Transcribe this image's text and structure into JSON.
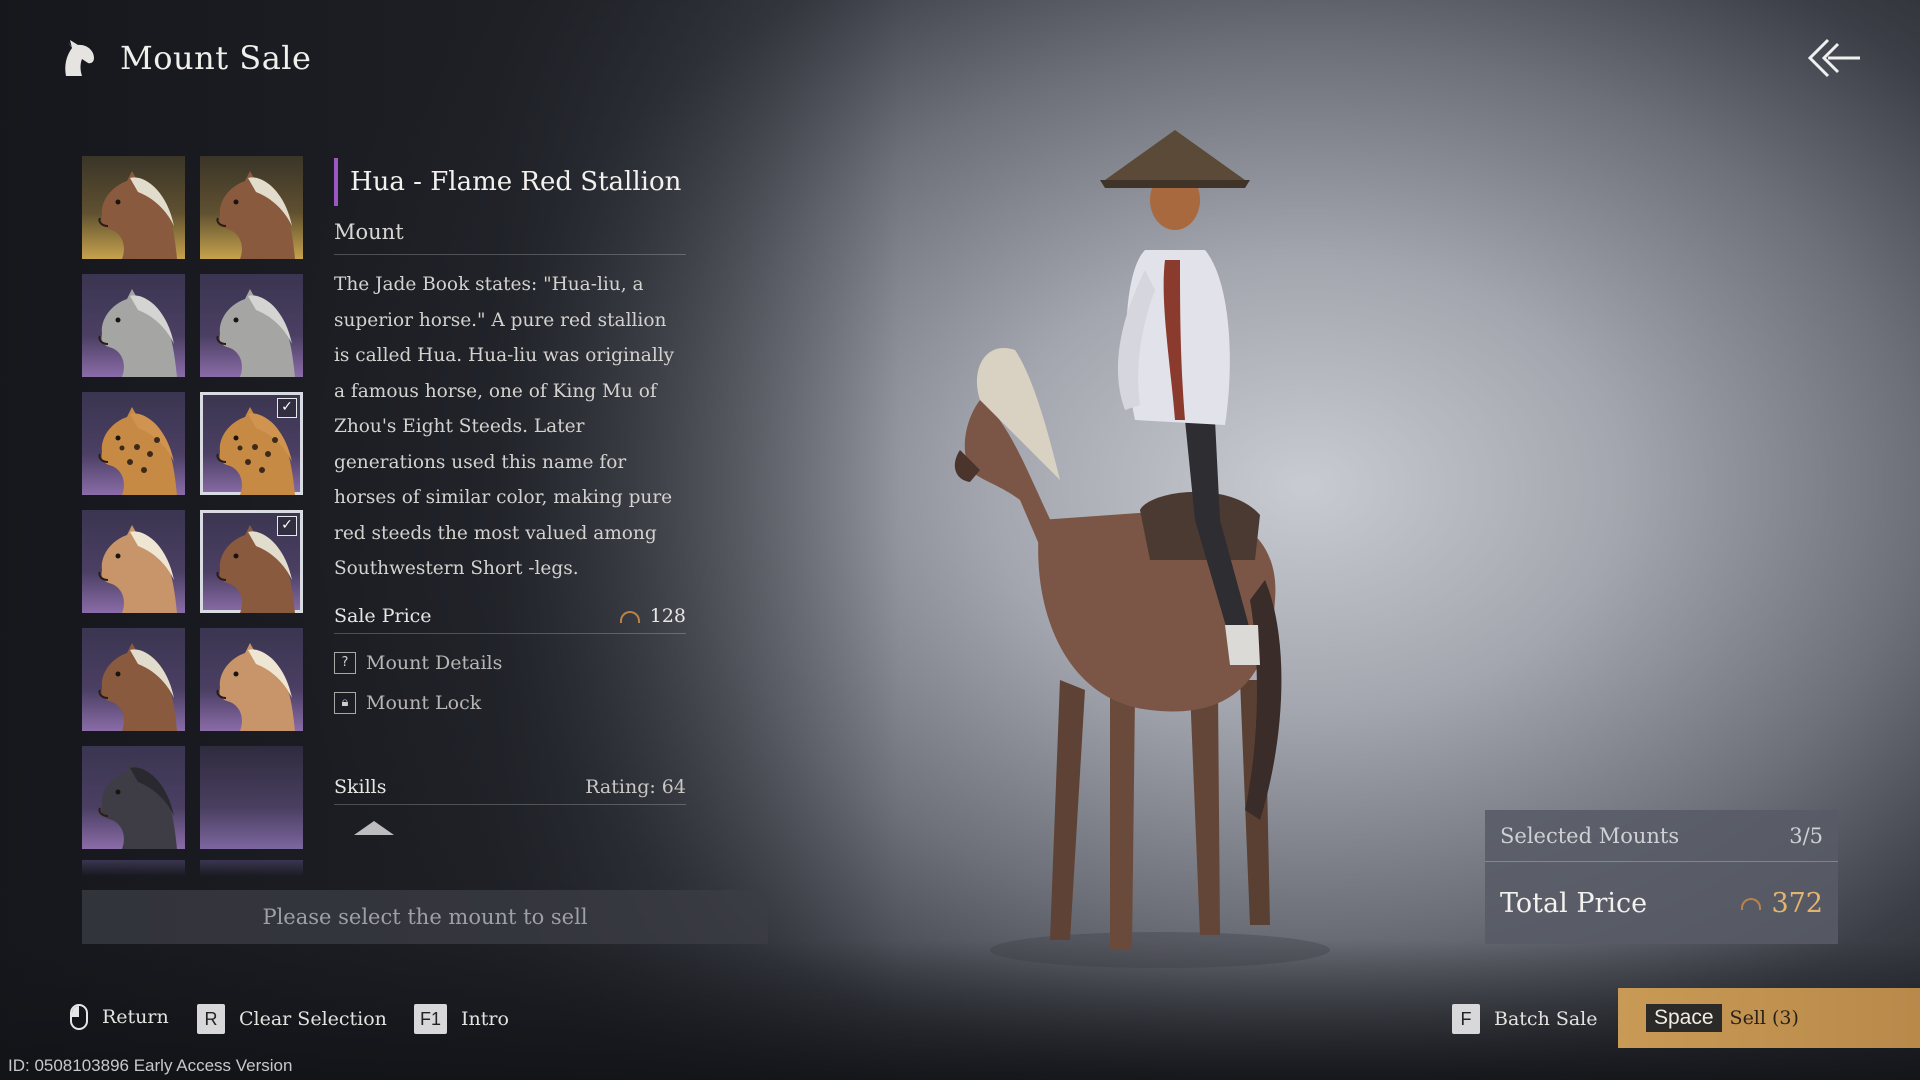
{
  "header": {
    "title": "Mount Sale",
    "logo_icon": "horse-head-icon"
  },
  "grid": {
    "cells": [
      {
        "coat": "chestnut",
        "bg": "gold",
        "selected": false
      },
      {
        "coat": "chestnut",
        "bg": "gold",
        "selected": false
      },
      {
        "coat": "grey",
        "bg": "purple",
        "selected": false
      },
      {
        "coat": "grey",
        "bg": "purple",
        "selected": false
      },
      {
        "coat": "leopard",
        "bg": "purple",
        "selected": false
      },
      {
        "coat": "leopard",
        "bg": "purple",
        "selected": true
      },
      {
        "coat": "palomino",
        "bg": "purple",
        "selected": false
      },
      {
        "coat": "chestnut",
        "bg": "purple",
        "selected": true
      },
      {
        "coat": "chestnut",
        "bg": "purple",
        "selected": false
      },
      {
        "coat": "palomino",
        "bg": "purple",
        "selected": false
      },
      {
        "coat": "black",
        "bg": "purple",
        "selected": false
      },
      {
        "coat": "none",
        "bg": "empty",
        "selected": false
      }
    ],
    "accent_purple": "#9b57c6"
  },
  "detail": {
    "name": "Hua - Flame Red Stallion",
    "type": "Mount",
    "description": "The Jade Book states: \"Hua-liu, a superior horse.\" A pure red stallion is called Hua. Hua-liu was originally a famous horse, one of King Mu of Zhou's Eight Steeds. Later generations used this name for horses of similar color, making pure red steeds the most valued among Southwestern Short -legs.",
    "sale_price_label": "Sale Price",
    "sale_price": "128",
    "mount_details_label": "Mount Details",
    "mount_lock_label": "Mount Lock",
    "skills_label": "Skills",
    "rating": "Rating: 64"
  },
  "select_prompt": "Please select the mount to sell",
  "summary": {
    "selected_label": "Selected Mounts",
    "selected_count": "3/5",
    "total_label": "Total Price",
    "total_price": "372"
  },
  "bottom": {
    "return_label": "Return",
    "clear_key": "R",
    "clear_label": "Clear Selection",
    "intro_key": "F1",
    "intro_label": "Intro",
    "batch_key": "F",
    "batch_label": "Batch Sale",
    "sell_key": "Space",
    "sell_label": "Sell (3)"
  },
  "version": "ID: 0508103896 Early Access Version"
}
